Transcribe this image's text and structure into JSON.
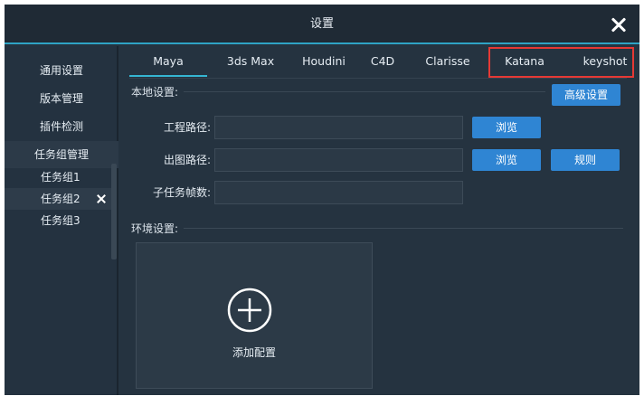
{
  "window": {
    "title": "设置"
  },
  "sidebar": {
    "items": [
      {
        "label": "通用设置"
      },
      {
        "label": "版本管理"
      },
      {
        "label": "插件检测"
      },
      {
        "label": "任务组管理"
      }
    ],
    "groups": [
      {
        "label": "任务组1"
      },
      {
        "label": "任务组2"
      },
      {
        "label": "任务组3"
      }
    ]
  },
  "tabs": [
    {
      "label": "Maya"
    },
    {
      "label": "3ds Max"
    },
    {
      "label": "Houdini"
    },
    {
      "label": "C4D"
    },
    {
      "label": "Clarisse"
    },
    {
      "label": "Katana"
    },
    {
      "label": "keyshot"
    }
  ],
  "local_settings": {
    "title": "本地设置:",
    "advanced_button": "高级设置",
    "project_path_label": "工程路径:",
    "project_path_value": "",
    "output_path_label": "出图路径:",
    "output_path_value": "",
    "subtask_frames_label": "子任务帧数:",
    "subtask_frames_value": "",
    "browse_label": "浏览",
    "rule_label": "规则"
  },
  "env_settings": {
    "title": "环境设置:",
    "add_config_label": "添加配置"
  },
  "colors": {
    "accent": "#2f85d3",
    "tab_underline": "#35b6d2",
    "highlight": "#e53935"
  }
}
